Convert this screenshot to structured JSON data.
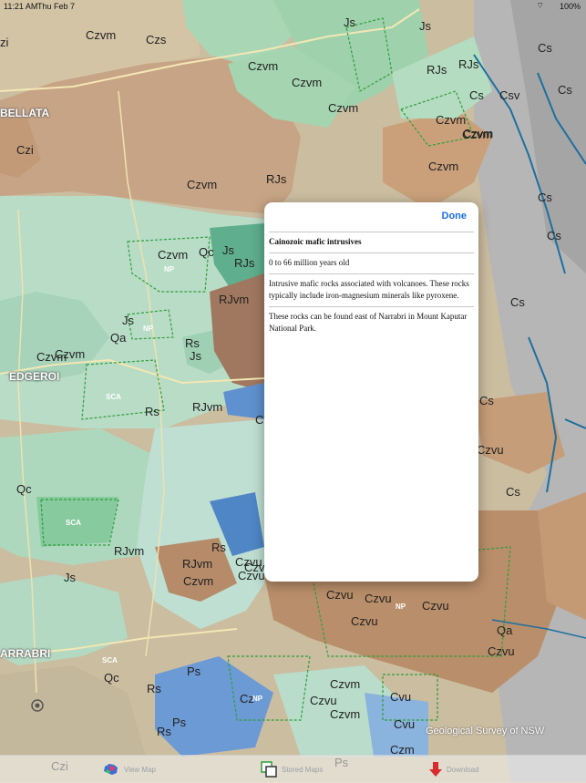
{
  "status_bar": {
    "time": "11:21 AM",
    "date": "Thu Feb 7",
    "battery": "100%",
    "wifi_icon": "wifi-icon"
  },
  "map": {
    "credit": "Geological Survey of NSW",
    "locate_icon": "location-target-icon",
    "towns": [
      "BELLATA",
      "EDGEROI",
      "ARRABRI"
    ],
    "park_labels": [
      "NP",
      "NP",
      "SCA",
      "SCA",
      "SCA",
      "NP",
      "NP"
    ],
    "unit_labels": [
      "zi",
      "Czvm",
      "Czs",
      "Js",
      "Js",
      "RJs",
      "RJs",
      "Czvm",
      "Czvm",
      "Czvm",
      "Czi",
      "Czvm",
      "RJs",
      "Czvm",
      "Czvm",
      "Czvm",
      "Czvm",
      "Cs",
      "Cs",
      "Cs",
      "Csv",
      "Cs",
      "Cs",
      "Czvm",
      "Qc",
      "Js",
      "RJs",
      "RJvm",
      "Js",
      "Qa",
      "Czvm",
      "Rs",
      "Js",
      "Czvm",
      "Rs",
      "RJvm",
      "Qc",
      "Cs",
      "Cs",
      "Czvu",
      "Cs",
      "Cz",
      "RJvm",
      "RJvm",
      "Rs",
      "Czvm",
      "Czvu",
      "Js",
      "Qc",
      "Rs",
      "Czvu",
      "Czvu",
      "Czvu",
      "Czvu",
      "Qa",
      "Czvu",
      "Ps",
      "Ps",
      "Rs",
      "Czvm",
      "Czvu",
      "Cvu",
      "Czvm",
      "Cvu",
      "Czm",
      "Cz",
      "Czi",
      "Ps",
      "Czvu",
      "Czvu"
    ],
    "colors": {
      "cainozoic_volcanic": "#a8d6b4",
      "sediments": "#c9ab86",
      "jurassic": "#b9dcc8",
      "hills": "#b99a7a",
      "fault_lines": "#1e6fa0"
    }
  },
  "popover": {
    "done_label": "Done",
    "title": "Cainozoic mafic intrusives",
    "age": "0 to 66 million years old",
    "description": "Intrusive mafic rocks associated with volcanoes. These rocks typically include iron-magnesium minerals like pyroxene.",
    "location": "These rocks can be found east of Narrabri in Mount Kaputar National Park."
  },
  "toolbar": {
    "view_map_label": "View Map",
    "view_map_icon": "australia-map-icon",
    "stored_maps_label": "Stored Maps",
    "stored_maps_icon": "stacked-squares-icon",
    "download_label": "Download",
    "download_icon": "download-arrow-icon"
  }
}
